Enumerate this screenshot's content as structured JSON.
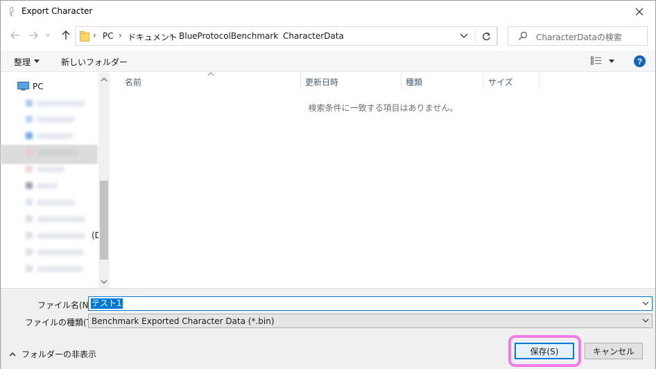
{
  "window": {
    "title": "Export Character",
    "close_label": "✕"
  },
  "address": {
    "crumbs": [
      "PC",
      "ドキュメント",
      "BlueProtocolBenchmark",
      "CharacterData"
    ],
    "separator": "›"
  },
  "search": {
    "placeholder": "CharacterDataの検索"
  },
  "toolbar": {
    "organize_label": "整理",
    "new_folder_label": "新しいフォルダー",
    "help_label": "?"
  },
  "navpane": {
    "pc_label": "PC",
    "fragment_label": "(D"
  },
  "filelist": {
    "columns": [
      "名前",
      "更新日時",
      "種類",
      "サイズ"
    ],
    "empty_message": "検索条件に一致する項目はありません。"
  },
  "form": {
    "filename_label": "ファイル名(N):",
    "filename_value": "テスト1",
    "filetype_label": "ファイルの種類(T):",
    "filetype_value": "Benchmark Exported Character Data (*.bin)",
    "hide_folders_label": "フォルダーの非表示",
    "save_label": "保存(S)",
    "cancel_label": "キャンセル"
  },
  "colors": {
    "accent": "#0078d7",
    "highlight_ring": "#f27ae6",
    "help_bg": "#1565c0"
  },
  "icons": [
    "app-icon",
    "close-icon",
    "back-arrow-icon",
    "forward-arrow-icon",
    "recent-dropdown-icon",
    "up-arrow-icon",
    "folder-icon",
    "refresh-icon",
    "search-icon",
    "view-options-icon",
    "help-icon",
    "pc-icon",
    "chevron-up-icon",
    "chevron-down-icon"
  ]
}
